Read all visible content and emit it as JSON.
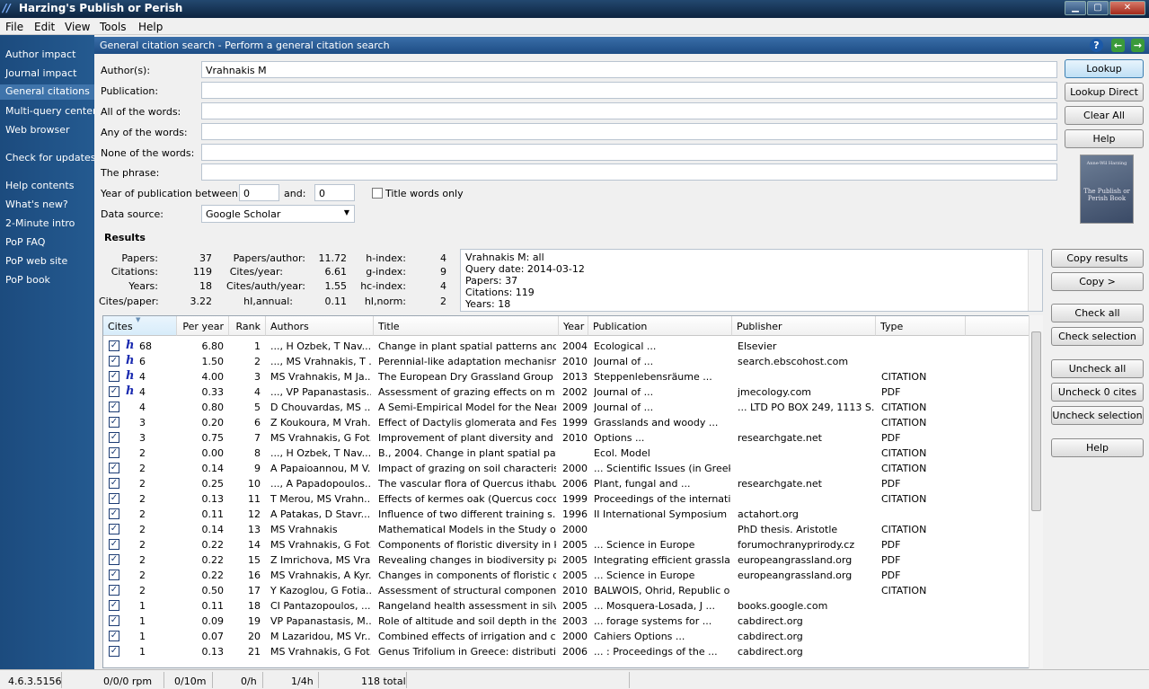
{
  "window": {
    "title": "Harzing's Publish or Perish",
    "controls": [
      "▁",
      "▢",
      "✕"
    ]
  },
  "menu": [
    "File",
    "Edit",
    "View",
    "Tools",
    "Help"
  ],
  "sidebar": {
    "items": [
      {
        "label": "Author impact"
      },
      {
        "label": "Journal impact"
      },
      {
        "label": "General citations"
      },
      {
        "label": "Multi-query center"
      },
      {
        "label": "Web browser"
      },
      {
        "label": "Check for updates"
      },
      {
        "label": "Help contents"
      },
      {
        "label": "What's new?"
      },
      {
        "label": "2-Minute intro"
      },
      {
        "label": "PoP FAQ"
      },
      {
        "label": "PoP web site"
      },
      {
        "label": "PoP book"
      }
    ],
    "active": "General citations"
  },
  "header": {
    "title": "General citation search - Perform a general citation search",
    "icons": [
      "help-icon",
      "back-icon",
      "forward-icon"
    ]
  },
  "form": {
    "authors_label": "Author(s):",
    "authors_value": "Vrahnakis M",
    "publication_label": "Publication:",
    "publication_value": "",
    "allwords_label": "All of the words:",
    "allwords_value": "",
    "anywords_label": "Any of the words:",
    "anywords_value": "",
    "nonewords_label": "None of the words:",
    "nonewords_value": "",
    "phrase_label": "The phrase:",
    "phrase_value": "",
    "year_label": "Year of publication between:",
    "year_from": "0",
    "year_and": "and:",
    "year_to": "0",
    "title_only_label": "Title words only",
    "title_only_checked": false,
    "source_label": "Data source:",
    "source_value": "Google Scholar"
  },
  "buttons": {
    "lookup": "Lookup",
    "lookup_direct": "Lookup Direct",
    "clear_all": "Clear All",
    "help": "Help",
    "copy_results": "Copy results",
    "copy": "Copy >",
    "check_all": "Check all",
    "check_selection": "Check selection",
    "uncheck_all": "Uncheck all",
    "uncheck_zero": "Uncheck 0 cites",
    "uncheck_selection": "Uncheck selection",
    "help2": "Help"
  },
  "book": {
    "title": "The Publish or Perish Book",
    "author": "Anne-Wil Harzing"
  },
  "results": {
    "heading": "Results",
    "stats": [
      {
        "label": "Papers:",
        "value": "37"
      },
      {
        "label": "Citations:",
        "value": "119"
      },
      {
        "label": "Years:",
        "value": "18"
      },
      {
        "label": "Cites/paper:",
        "value": "3.22"
      },
      {
        "label": "Papers/author:",
        "value": "11.72"
      },
      {
        "label": "Cites/year:",
        "value": "6.61"
      },
      {
        "label": "Cites/auth/year:",
        "value": "1.55"
      },
      {
        "label": "hI,annual:",
        "value": "0.11"
      },
      {
        "label": "h-index:",
        "value": "4"
      },
      {
        "label": "g-index:",
        "value": "9"
      },
      {
        "label": "hc-index:",
        "value": "4"
      },
      {
        "label": "hI,norm:",
        "value": "2"
      }
    ],
    "summary": [
      "Vrahnakis M: all",
      "Query date: 2014-03-12",
      "Papers: 37",
      "Citations: 119",
      "Years: 18"
    ]
  },
  "table": {
    "columns": [
      "Cites",
      "Per year",
      "Rank",
      "Authors",
      "Title",
      "Year",
      "Publication",
      "Publisher",
      "Type"
    ],
    "rows": [
      {
        "h": true,
        "cites": "68",
        "per_year": "6.80",
        "rank": "1",
        "authors": "..., H Ozbek, T Nav...",
        "title": "Change in plant spatial patterns and...",
        "year": "2004",
        "publication": "Ecological ...",
        "publisher": "Elsevier",
        "type": ""
      },
      {
        "h": true,
        "cites": "6",
        "per_year": "1.50",
        "rank": "2",
        "authors": "..., MS Vrahnakis, T ...",
        "title": "Perennial-like adaptation mechanism...",
        "year": "2010",
        "publication": "Journal of ...",
        "publisher": "search.ebscohost.com",
        "type": ""
      },
      {
        "h": true,
        "cites": "4",
        "per_year": "4.00",
        "rank": "3",
        "authors": "MS Vrahnakis, M Ja...",
        "title": "The European Dry Grassland Group (...",
        "year": "2013",
        "publication": "Steppenlebensräume ...",
        "publisher": "",
        "type": "CITATION"
      },
      {
        "h": true,
        "cites": "4",
        "per_year": "0.33",
        "rank": "4",
        "authors": "..., VP Papanastasis...",
        "title": "Assessment of grazing effects on m...",
        "year": "2002",
        "publication": "Journal of ...",
        "publisher": "jmecology.com",
        "type": "PDF"
      },
      {
        "h": false,
        "cites": "4",
        "per_year": "0.80",
        "rank": "5",
        "authors": "D Chouvardas, MS ...",
        "title": "A Semi-Empirical Model for the Near ...",
        "year": "2009",
        "publication": "Journal of ...",
        "publisher": "... LTD PO BOX 249, 1113 S...",
        "type": "CITATION"
      },
      {
        "h": false,
        "cites": "3",
        "per_year": "0.20",
        "rank": "6",
        "authors": "Z Koukoura, M Vrah...",
        "title": "Effect of Dactylis glomerata and Fes...",
        "year": "1999",
        "publication": "Grasslands and woody ...",
        "publisher": "",
        "type": "CITATION"
      },
      {
        "h": false,
        "cites": "3",
        "per_year": "0.75",
        "rank": "7",
        "authors": "MS Vrahnakis, G Fot...",
        "title": "Improvement of plant diversity and ...",
        "year": "2010",
        "publication": "Options ...",
        "publisher": "researchgate.net",
        "type": "PDF"
      },
      {
        "h": false,
        "cites": "2",
        "per_year": "0.00",
        "rank": "8",
        "authors": "..., H Ozbek, T Nav...",
        "title": "B., 2004. Change in plant spatial pat...",
        "year": "",
        "publication": "Ecol. Model",
        "publisher": "",
        "type": "CITATION"
      },
      {
        "h": false,
        "cites": "2",
        "per_year": "0.14",
        "rank": "9",
        "authors": "A Papaioannou, M V...",
        "title": "Impact of grazing on soil characteris...",
        "year": "2000",
        "publication": "... Scientific Issues (in Greek)",
        "publisher": "",
        "type": "CITATION"
      },
      {
        "h": false,
        "cites": "2",
        "per_year": "0.25",
        "rank": "10",
        "authors": "..., A Papadopoulos...",
        "title": "The vascular flora of Quercus ithabu...",
        "year": "2006",
        "publication": "Plant, fungal and ...",
        "publisher": "researchgate.net",
        "type": "PDF"
      },
      {
        "h": false,
        "cites": "2",
        "per_year": "0.13",
        "rank": "11",
        "authors": "T Merou, MS Vrahn...",
        "title": "Effects of kermes oak (Quercus cocc...",
        "year": "1999",
        "publication": "Proceedings of the internati...",
        "publisher": "",
        "type": "CITATION"
      },
      {
        "h": false,
        "cites": "2",
        "per_year": "0.11",
        "rank": "12",
        "authors": "A Patakas, D Stavr...",
        "title": "Influence of two different training s...",
        "year": "1996",
        "publication": "II International Symposium ...",
        "publisher": "actahort.org",
        "type": ""
      },
      {
        "h": false,
        "cites": "2",
        "per_year": "0.14",
        "rank": "13",
        "authors": "MS Vrahnakis",
        "title": "Mathematical Models in the Study of ...",
        "year": "2000",
        "publication": "",
        "publisher": "PhD thesis. Aristotle",
        "type": "CITATION"
      },
      {
        "h": false,
        "cites": "2",
        "per_year": "0.22",
        "rank": "14",
        "authors": "MS Vrahnakis, G Fot...",
        "title": "Components of floristic diversity in k...",
        "year": "2005",
        "publication": "... Science in Europe",
        "publisher": "forumochranyprirody.cz",
        "type": "PDF"
      },
      {
        "h": false,
        "cites": "2",
        "per_year": "0.22",
        "rank": "15",
        "authors": "Z Imrichova, MS Vra...",
        "title": "Revealing changes in biodiversity pa...",
        "year": "2005",
        "publication": "Integrating efficient grassla...",
        "publisher": "europeangrassland.org",
        "type": "PDF"
      },
      {
        "h": false,
        "cites": "2",
        "per_year": "0.22",
        "rank": "16",
        "authors": "MS Vrahnakis, A Kyr...",
        "title": "Changes in components of floristic di...",
        "year": "2005",
        "publication": "... Science in Europe",
        "publisher": "europeangrassland.org",
        "type": "PDF"
      },
      {
        "h": false,
        "cites": "2",
        "per_year": "0.50",
        "rank": "17",
        "authors": "Y Kazoglou, G Fotia...",
        "title": "Assessment of structural component...",
        "year": "2010",
        "publication": "BALWOIS, Ohrid, Republic o...",
        "publisher": "",
        "type": "CITATION"
      },
      {
        "h": false,
        "cites": "1",
        "per_year": "0.11",
        "rank": "18",
        "authors": "CI Pantazopoulos, ...",
        "title": "Rangeland health assessment in silv...",
        "year": "2005",
        "publication": "... Mosquera-Losada, J ...",
        "publisher": "books.google.com",
        "type": ""
      },
      {
        "h": false,
        "cites": "1",
        "per_year": "0.09",
        "rank": "19",
        "authors": "VP Papanastasis, M...",
        "title": "Role of altitude and soil depth in the ...",
        "year": "2003",
        "publication": "... forage systems for ...",
        "publisher": "cabdirect.org",
        "type": ""
      },
      {
        "h": false,
        "cites": "1",
        "per_year": "0.07",
        "rank": "20",
        "authors": "M Lazaridou, MS Vr...",
        "title": "Combined effects of irrigation and c...",
        "year": "2000",
        "publication": "Cahiers Options ...",
        "publisher": "cabdirect.org",
        "type": ""
      },
      {
        "h": false,
        "cites": "1",
        "per_year": "0.13",
        "rank": "21",
        "authors": "MS Vrahnakis, G Fot...",
        "title": "Genus Trifolium in Greece: distributio...",
        "year": "2006",
        "publication": "... : Proceedings of the ...",
        "publisher": "cabdirect.org",
        "type": ""
      }
    ]
  },
  "status": {
    "version": "4.6.3.5156",
    "rpm": "0/0/0 rpm",
    "min": "0/10m",
    "hour": "0/h",
    "quarter": "1/4h",
    "total": "118 total"
  }
}
